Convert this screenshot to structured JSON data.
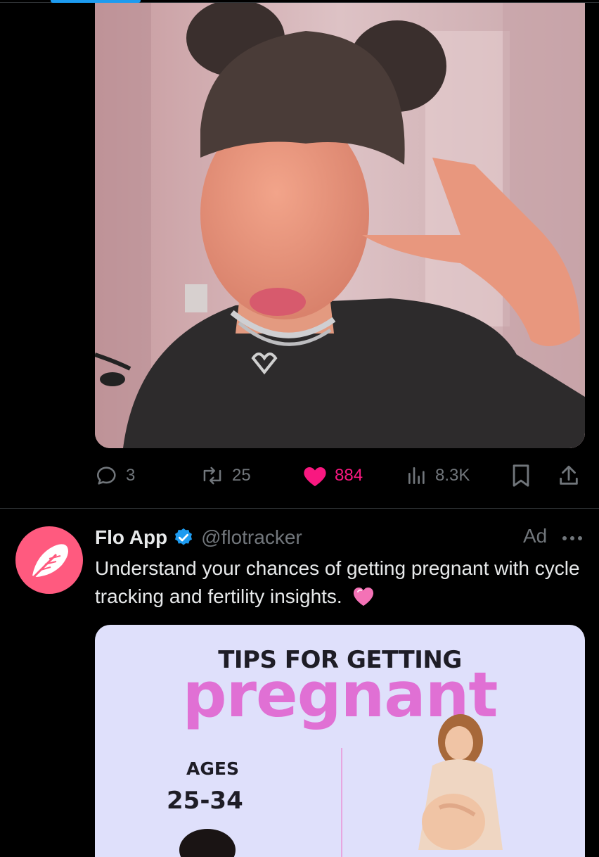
{
  "post": {
    "media_alt": "photo",
    "actions": {
      "replies": "3",
      "reposts": "25",
      "likes": "884",
      "views": "8.3K"
    }
  },
  "ad": {
    "name": "Flo App",
    "handle": "@flotracker",
    "ad_label": "Ad",
    "text": "Understand your chances of getting pregnant with cycle tracking and fertility insights.",
    "media": {
      "title": "TIPS FOR GETTING",
      "headline": "pregnant",
      "ages_label": "AGES",
      "ages_range": "25-34"
    }
  },
  "colors": {
    "background": "#000000",
    "accent": "#1d9bf0",
    "like": "#f91880",
    "muted": "#71767b",
    "flo_brand": "#ff5a7f",
    "headline_pink": "#e070d4"
  },
  "icons": [
    "reply-icon",
    "repost-icon",
    "like-icon",
    "views-icon",
    "bookmark-icon",
    "share-icon",
    "verified-badge-icon",
    "more-icon",
    "feather-logo-icon",
    "pink-heart-emoji-icon"
  ]
}
